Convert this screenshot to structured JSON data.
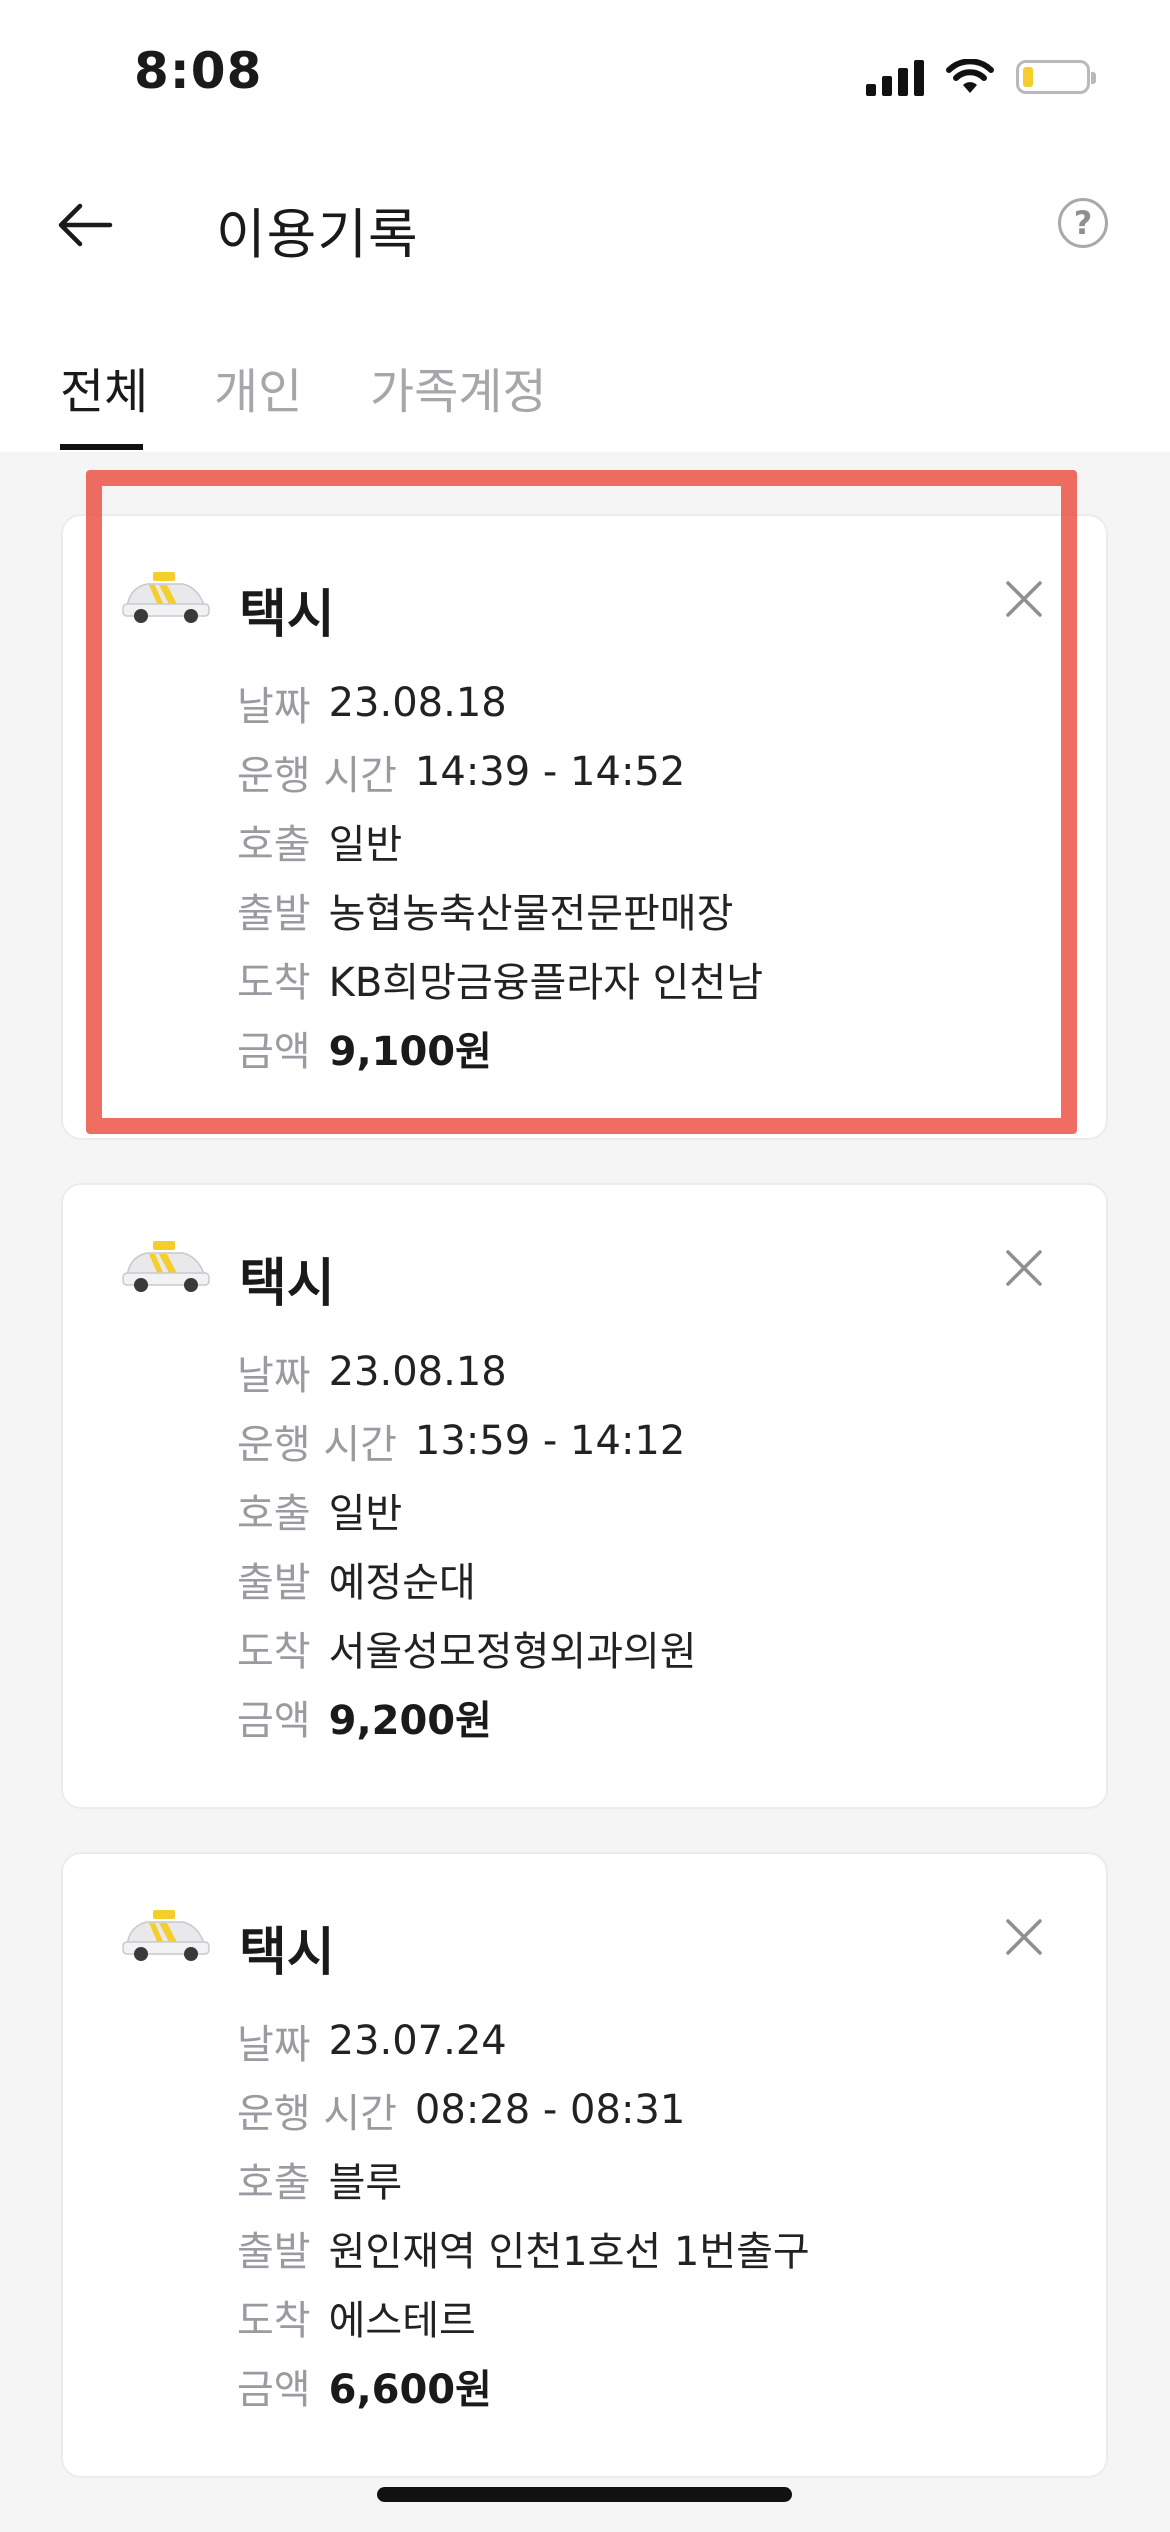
{
  "status": {
    "time": "8:08"
  },
  "header": {
    "title": "이용기록",
    "help": "?"
  },
  "tabs": [
    {
      "label": "전체"
    },
    {
      "label": "개인"
    },
    {
      "label": "가족계정"
    }
  ],
  "labels": {
    "date": "날짜",
    "time": "운행 시간",
    "call": "호출",
    "from": "출발",
    "to": "도착",
    "fare": "금액"
  },
  "records": [
    {
      "type": "택시",
      "date": "23.08.18",
      "time": "14:39 - 14:52",
      "call": "일반",
      "from": "농협농축산물전문판매장",
      "to": "KB희망금융플라자 인천남",
      "fare": "9,100원"
    },
    {
      "type": "택시",
      "date": "23.08.18",
      "time": "13:59 - 14:12",
      "call": "일반",
      "from": "예정순대",
      "to": "서울성모정형외과의원",
      "fare": "9,200원"
    },
    {
      "type": "택시",
      "date": "23.07.24",
      "time": "08:28 - 08:31",
      "call": "블루",
      "from": "원인재역 인천1호선 1번출구",
      "to": "에스테르",
      "fare": "6,600원"
    }
  ],
  "colors": {
    "highlight": "#ec483a",
    "accent_yellow": "#f4cf2b"
  }
}
